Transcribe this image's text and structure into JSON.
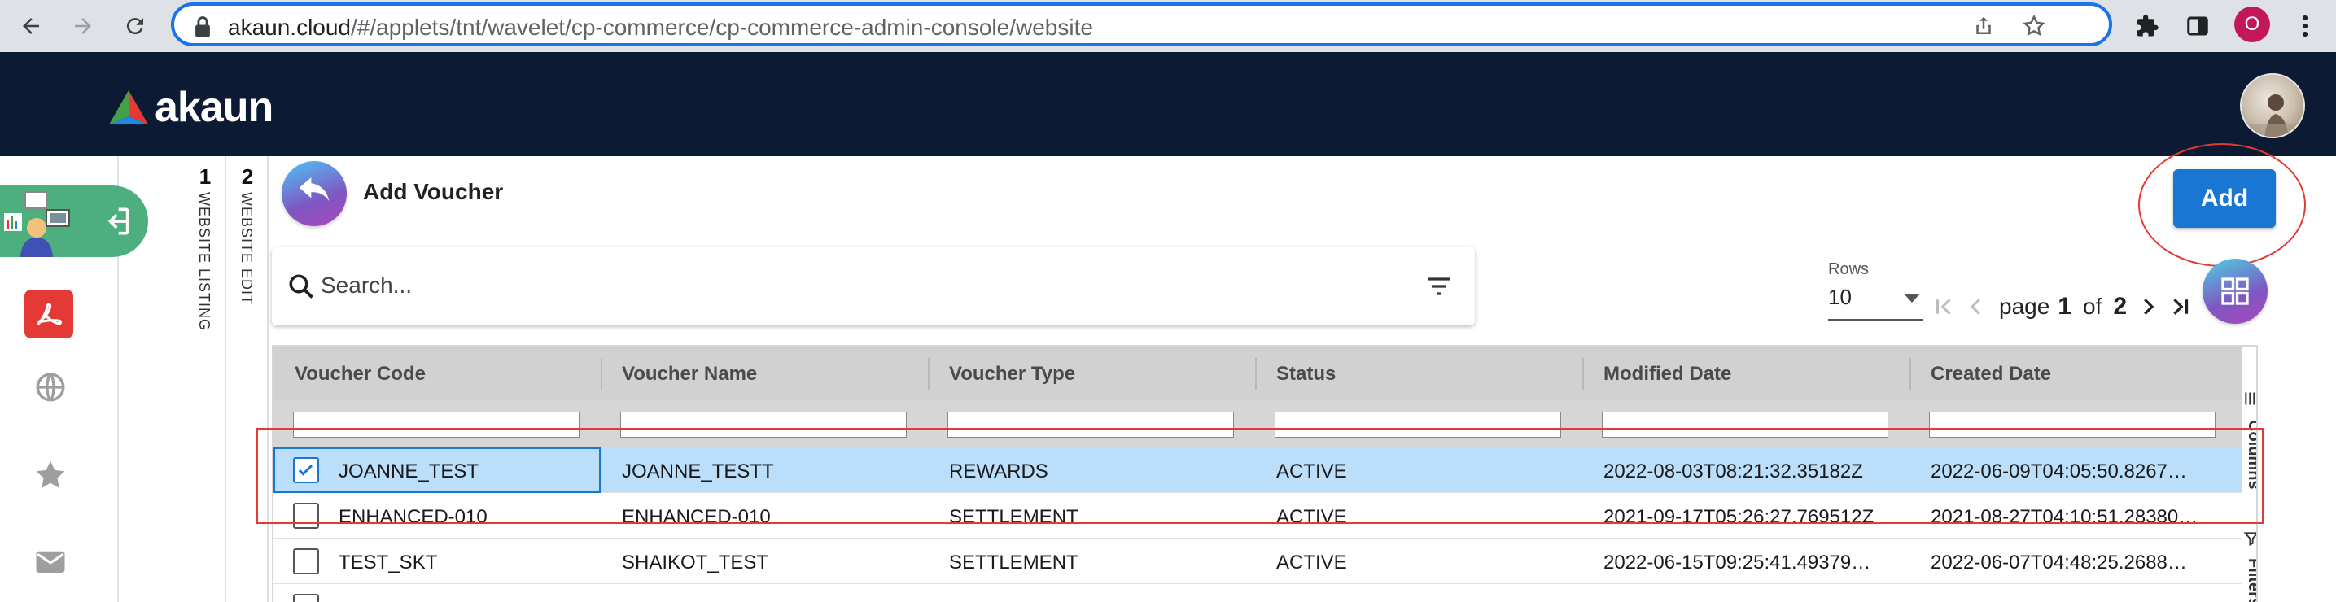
{
  "browser": {
    "url_host": "akaun.cloud",
    "url_path": "/#/applets/tnt/wavelet/cp-commerce/cp-commerce-admin-console/website",
    "profile_initial": "O"
  },
  "app": {
    "logo_text": "akaun"
  },
  "breadcrumb": {
    "tabs": [
      {
        "num": "1",
        "label": "WEBSITE LISTING"
      },
      {
        "num": "2",
        "label": "WEBSITE EDIT"
      }
    ]
  },
  "page": {
    "title": "Add Voucher",
    "add_label": "Add"
  },
  "search": {
    "placeholder": "Search..."
  },
  "pagination": {
    "rows_label": "Rows",
    "rows_value": "10",
    "page_word": "page",
    "current_page": "1",
    "of_word": "of",
    "total_pages": "2"
  },
  "table": {
    "columns": [
      "Voucher Code",
      "Voucher Name",
      "Voucher Type",
      "Status",
      "Modified Date",
      "Created Date"
    ],
    "rows": [
      {
        "selected": true,
        "cells": [
          "JOANNE_TEST",
          "JOANNE_TESTT",
          "REWARDS",
          "ACTIVE",
          "2022-08-03T08:21:32.35182Z",
          "2022-06-09T04:05:50.8267…"
        ]
      },
      {
        "selected": false,
        "cells": [
          "ENHANCED-010",
          "ENHANCED-010",
          "SETTLEMENT",
          "ACTIVE",
          "2021-09-17T05:26:27.769512Z",
          "2021-08-27T04:10:51.28380…"
        ]
      },
      {
        "selected": false,
        "cells": [
          "TEST_SKT",
          "SHAIKOT_TEST",
          "SETTLEMENT",
          "ACTIVE",
          "2022-06-15T09:25:41.49379…",
          "2022-06-07T04:48:25.2688…"
        ]
      }
    ],
    "side_tabs": [
      "Columns",
      "Filters"
    ]
  },
  "colors": {
    "header_bg": "#0c1b33",
    "accent": "#1976d2",
    "active_side": "#4caf7d",
    "selected_row": "#bbdefb"
  }
}
